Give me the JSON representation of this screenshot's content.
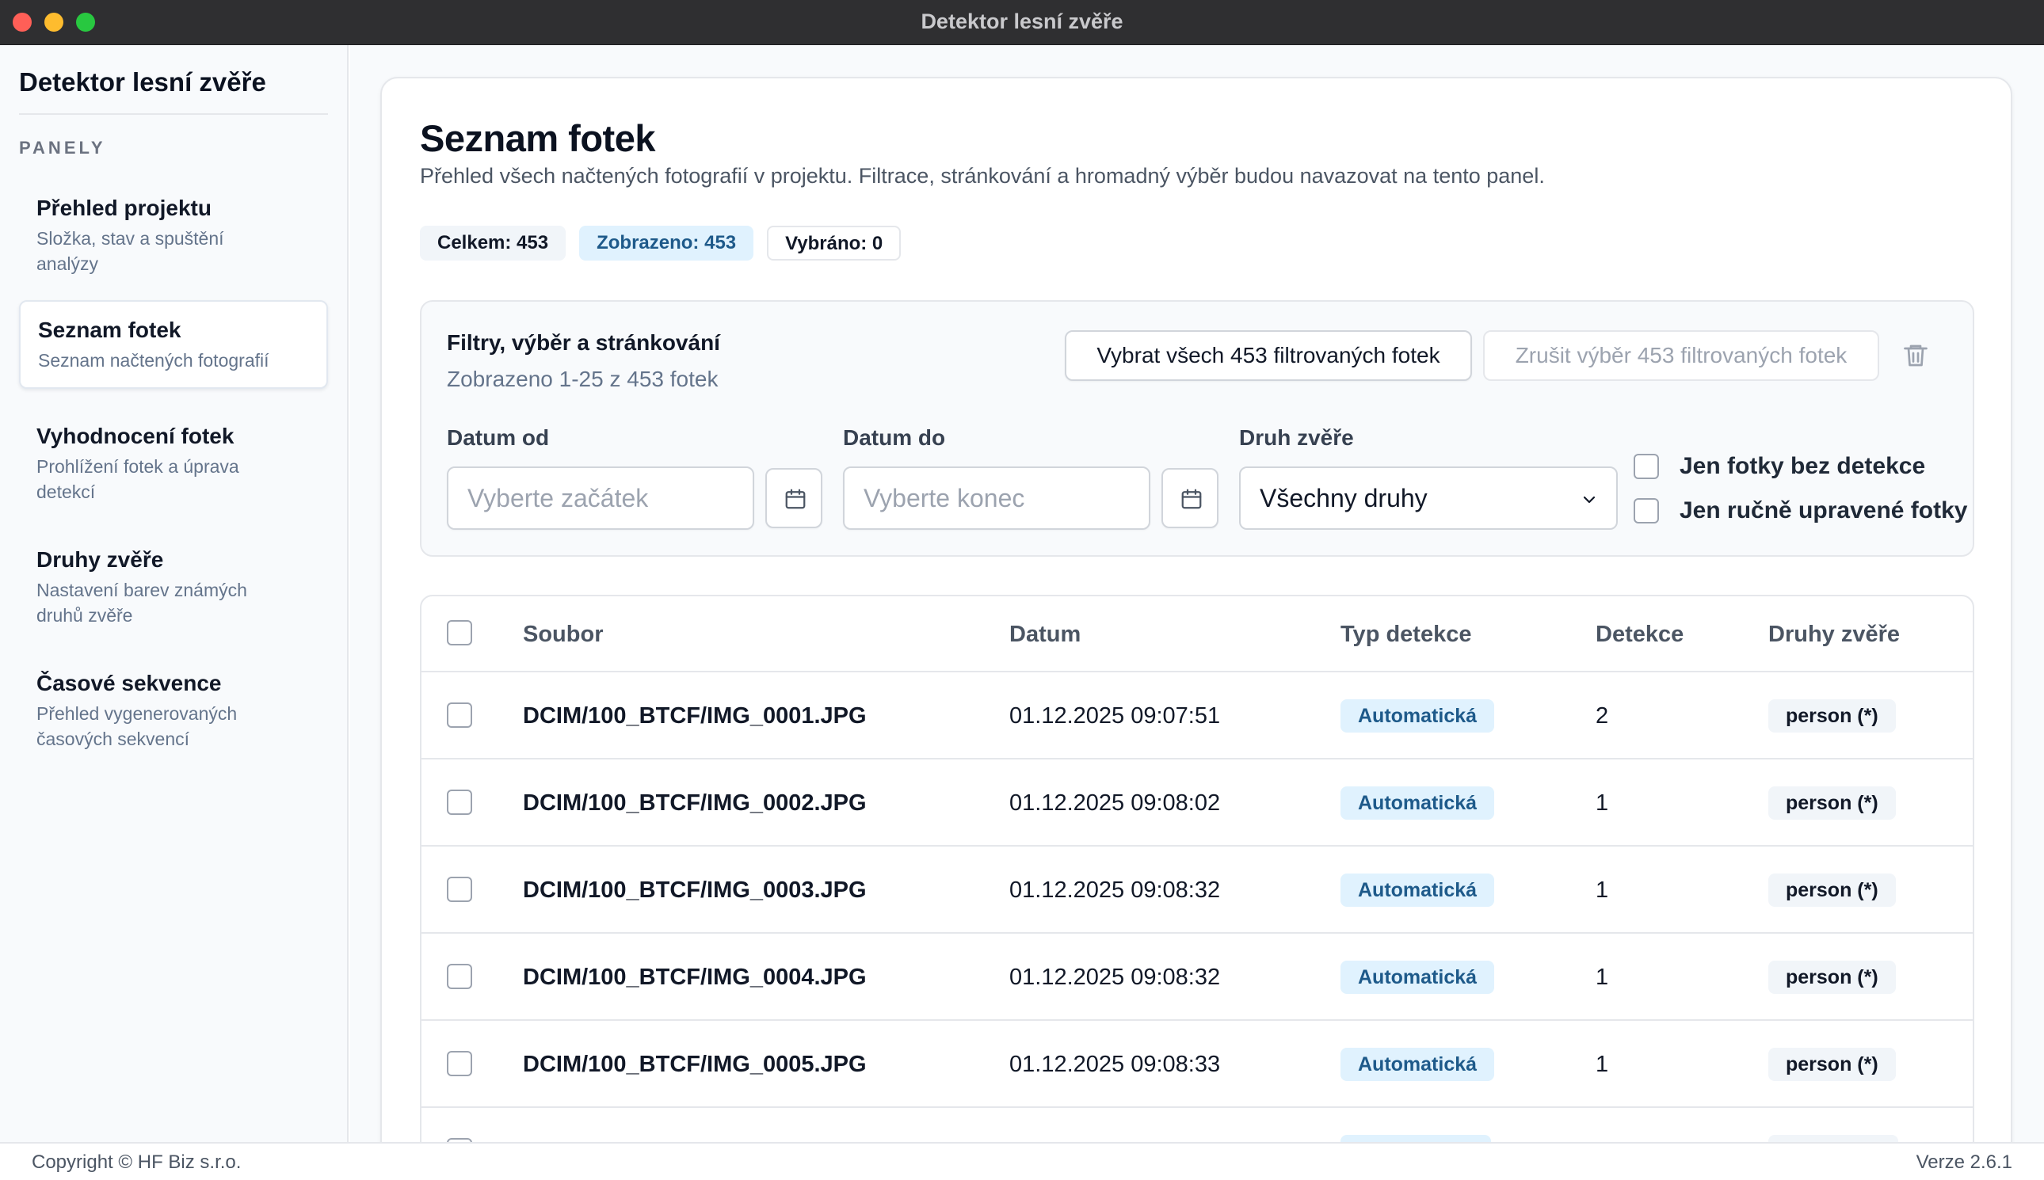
{
  "window": {
    "title": "Detektor lesní zvěře"
  },
  "sidebar": {
    "app_name": "Detektor lesní zvěře",
    "section_heading": "PANELY",
    "items": [
      {
        "title": "Přehled projektu",
        "subtitle": "Složka, stav a spuštění analýzy",
        "active": false
      },
      {
        "title": "Seznam fotek",
        "subtitle": "Seznam načtených fotografií",
        "active": true
      },
      {
        "title": "Vyhodnocení fotek",
        "subtitle": "Prohlížení fotek a úprava detekcí",
        "active": false
      },
      {
        "title": "Druhy zvěře",
        "subtitle": "Nastavení barev známých druhů zvěře",
        "active": false
      },
      {
        "title": "Časové sekvence",
        "subtitle": "Přehled vygenerovaných časových sekvencí",
        "active": false
      }
    ]
  },
  "main": {
    "title": "Seznam fotek",
    "description": "Přehled všech načtených fotografií v projektu. Filtrace, stránkování a hromadný výběr budou navazovat na tento panel.",
    "badges": {
      "total": "Celkem: 453",
      "shown": "Zobrazeno: 453",
      "selected": "Vybráno: 0"
    },
    "filters": {
      "title": "Filtry, výběr a stránkování",
      "range_text": "Zobrazeno 1-25 z 453 fotek",
      "select_all_label": "Vybrat všech 453 filtrovaných fotek",
      "clear_selection_label": "Zrušit výběr 453 filtrovaných fotek",
      "date_from_label": "Datum od",
      "date_from_placeholder": "Vyberte začátek",
      "date_to_label": "Datum do",
      "date_to_placeholder": "Vyberte konec",
      "species_label": "Druh zvěře",
      "species_selected": "Všechny druhy",
      "only_no_detection_label": "Jen fotky bez detekce",
      "only_manual_label": "Jen ručně upravené fotky"
    },
    "table": {
      "columns": [
        "Soubor",
        "Datum",
        "Typ detekce",
        "Detekce",
        "Druhy zvěře"
      ],
      "rows": [
        {
          "file": "DCIM/100_BTCF/IMG_0001.JPG",
          "date": "01.12.2025 09:07:51",
          "type": "Automatická",
          "count": "2",
          "species": "person (*)"
        },
        {
          "file": "DCIM/100_BTCF/IMG_0002.JPG",
          "date": "01.12.2025 09:08:02",
          "type": "Automatická",
          "count": "1",
          "species": "person (*)"
        },
        {
          "file": "DCIM/100_BTCF/IMG_0003.JPG",
          "date": "01.12.2025 09:08:32",
          "type": "Automatická",
          "count": "1",
          "species": "person (*)"
        },
        {
          "file": "DCIM/100_BTCF/IMG_0004.JPG",
          "date": "01.12.2025 09:08:32",
          "type": "Automatická",
          "count": "1",
          "species": "person (*)"
        },
        {
          "file": "DCIM/100_BTCF/IMG_0005.JPG",
          "date": "01.12.2025 09:08:33",
          "type": "Automatická",
          "count": "1",
          "species": "person (*)"
        }
      ]
    }
  },
  "footer": {
    "copyright": "Copyright © HF Biz s.r.o.",
    "version": "Verze 2.6.1"
  },
  "icons": {
    "calendar": "calendar-icon",
    "trash": "trash-icon",
    "chevron": "chevron-down-icon"
  },
  "colors": {
    "accent_badge_bg": "#e0f2fe",
    "accent_badge_text": "#1e5a8a",
    "titlebar": "#2f2f31"
  }
}
